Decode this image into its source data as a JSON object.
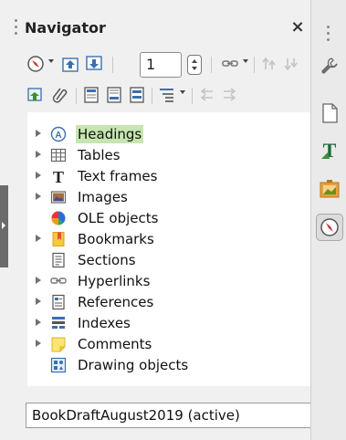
{
  "panel": {
    "title": "Navigator",
    "close_label": "×"
  },
  "toolbar": {
    "level_value": "1",
    "icons": [
      "navigate-by-icon",
      "previous-icon",
      "next-icon",
      "page-spin",
      "drag-mode-icon",
      "promote-chapter-icon",
      "demote-chapter-icon",
      "insert-icon",
      "content-navigation-icon",
      "header-icon",
      "footer-icon",
      "anchor-icon",
      "outline-level-icon",
      "promote-level-icon",
      "demote-level-icon"
    ]
  },
  "tree": {
    "items": [
      {
        "label": "Headings",
        "icon": "headings-icon",
        "expandable": true,
        "highlighted": true
      },
      {
        "label": "Tables",
        "icon": "table-icon",
        "expandable": true
      },
      {
        "label": "Text frames",
        "icon": "text-frame-icon",
        "expandable": true
      },
      {
        "label": "Images",
        "icon": "image-icon",
        "expandable": true
      },
      {
        "label": "OLE objects",
        "icon": "ole-object-icon",
        "expandable": false
      },
      {
        "label": "Bookmarks",
        "icon": "bookmark-icon",
        "expandable": true
      },
      {
        "label": "Sections",
        "icon": "section-icon",
        "expandable": false
      },
      {
        "label": "Hyperlinks",
        "icon": "hyperlink-icon",
        "expandable": true
      },
      {
        "label": "References",
        "icon": "reference-icon",
        "expandable": true
      },
      {
        "label": "Indexes",
        "icon": "index-icon",
        "expandable": true
      },
      {
        "label": "Comments",
        "icon": "comment-icon",
        "expandable": true
      },
      {
        "label": "Drawing objects",
        "icon": "drawing-object-icon",
        "expandable": false
      }
    ]
  },
  "document_selector": {
    "value": "BookDraftAugust2019 (active)"
  },
  "sidebar": {
    "buttons": [
      "properties-icon",
      "page-icon",
      "styles-icon",
      "gallery-icon",
      "navigator-icon"
    ]
  },
  "colors": {
    "highlight": "#c6e5b0",
    "accent_blue": "#3a6fb0",
    "accent_green": "#3c8d3c"
  }
}
